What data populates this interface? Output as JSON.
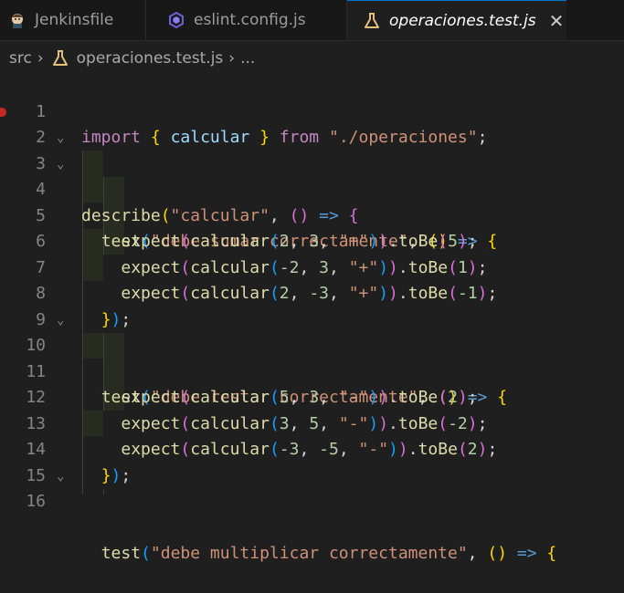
{
  "tabs": [
    {
      "label": "Jenkinsfile",
      "icon": "jenkins-icon"
    },
    {
      "label": "eslint.config.js",
      "icon": "eslint-icon"
    },
    {
      "label": "operaciones.test.js",
      "icon": "flask-icon",
      "close": "✕"
    }
  ],
  "breadcrumb": {
    "folder": "src",
    "file": "operaciones.test.js",
    "more": "..."
  },
  "lines": [
    {
      "n": "1"
    },
    {
      "n": "2"
    },
    {
      "n": "3"
    },
    {
      "n": "4"
    },
    {
      "n": "5"
    },
    {
      "n": "6"
    },
    {
      "n": "7"
    },
    {
      "n": "8"
    },
    {
      "n": "9"
    },
    {
      "n": "10"
    },
    {
      "n": "11"
    },
    {
      "n": "12"
    },
    {
      "n": "13"
    },
    {
      "n": "14"
    },
    {
      "n": "15"
    },
    {
      "n": "16"
    }
  ],
  "code": {
    "import_kw": "import",
    "import_name": "calcular",
    "from_kw": "from",
    "import_path": "\"./operaciones\"",
    "describe_fn": "describe",
    "describe_name": "\"calcular\"",
    "test_fn": "test",
    "expect_fn": "expect",
    "calc_fn": "calcular",
    "tobe_fn": "toBe",
    "t1_name": "\"debe sumar correctamente\"",
    "t2_name": "\"debe restar correctamente\"",
    "t3_name": "\"debe multiplicar correctamente\"",
    "op_plus": "\"+\"",
    "op_minus": "\"-\"",
    "e1": {
      "a": "2",
      "b": "3",
      "r": "5"
    },
    "e2": {
      "a": "-2",
      "b": "3",
      "r": "1"
    },
    "e3": {
      "a": "2",
      "b": "-3",
      "r": "-1"
    },
    "e4": {
      "a": "5",
      "b": "3",
      "r": "2"
    },
    "e5": {
      "a": "3",
      "b": "5",
      "r": "-2"
    },
    "e6": {
      "a": "-3",
      "b": "-5",
      "r": "2"
    }
  },
  "colors": {
    "accent": "#0078d4",
    "background": "#1f1f1f",
    "keyword": "#c586c0",
    "function": "#dcdcaa",
    "string": "#ce9178",
    "number": "#b5cea8"
  }
}
